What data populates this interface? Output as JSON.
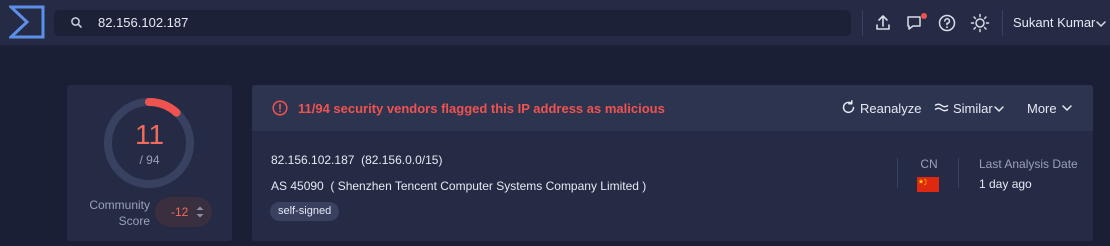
{
  "header": {
    "search_value": "82.156.102.187",
    "user_name": "Sukant Kumar"
  },
  "icons": {
    "logo": "virustotal-logo-icon",
    "search": "search-icon",
    "upload": "upload-icon",
    "notifications": "chat-notification-icon",
    "help": "help-icon",
    "theme": "sun-icon",
    "user_menu": "chevron-down-icon"
  },
  "score": {
    "detections": "11",
    "total": "/ 94",
    "detection_fraction": 0.117,
    "community_label": "Community Score",
    "community_value": "-12"
  },
  "summary": {
    "alert_text": "11/94 security vendors flagged this IP address as malicious",
    "actions": {
      "reanalyze": "Reanalyze",
      "similar": "Similar",
      "more": "More"
    },
    "ip_line": "82.156.102.187  (82.156.0.0/15)",
    "as_line": "AS 45090  ( Shenzhen Tencent Computer Systems Company Limited )",
    "tag": "self-signed",
    "country_code": "CN",
    "last_analysis_label": "Last Analysis Date",
    "last_analysis_value": "1 day ago"
  },
  "colors": {
    "background": "#1a1f36",
    "card": "#252b45",
    "danger": "#ef5350",
    "score_red": "#ef6b5b",
    "flag_red": "#de2910",
    "flag_yellow": "#ffde00"
  }
}
